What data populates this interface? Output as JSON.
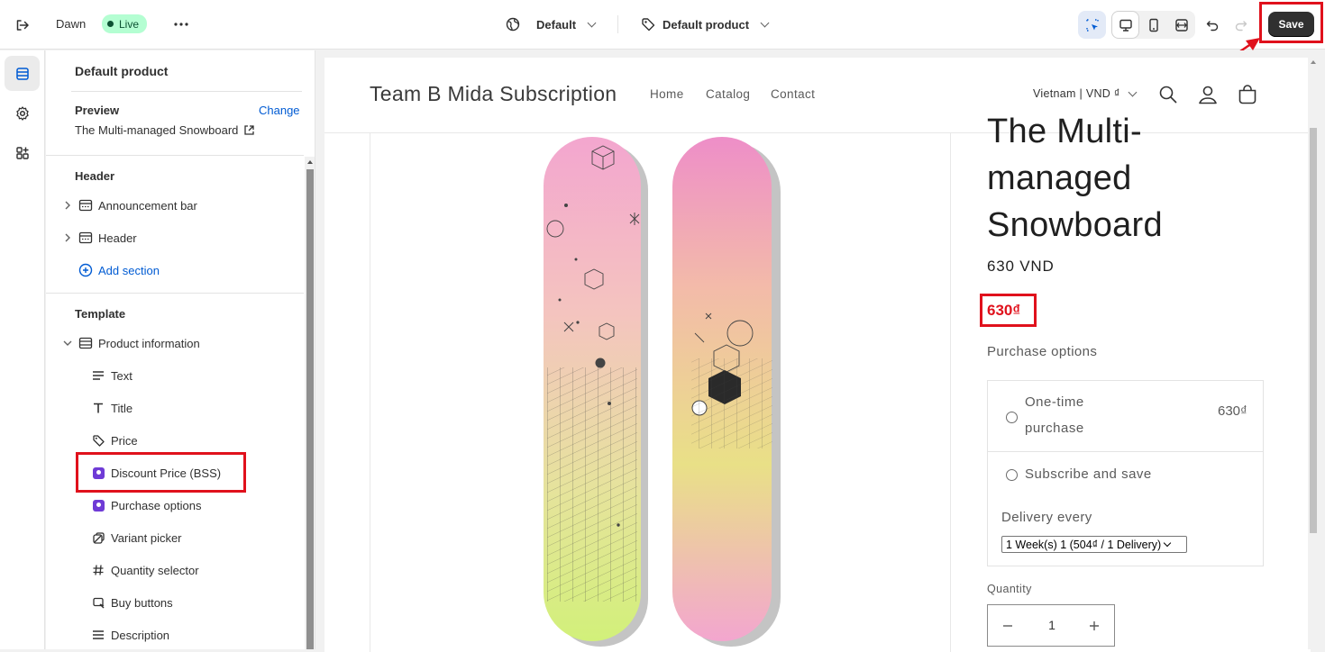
{
  "topbar": {
    "theme_name": "Dawn",
    "live_label": "Live",
    "more_label": "•••",
    "global_selector": "Default",
    "product_selector": "Default product",
    "save_label": "Save"
  },
  "panel": {
    "title": "Default product",
    "preview_label": "Preview",
    "change_label": "Change",
    "preview_value": "The Multi-managed Snowboard",
    "header_section_title": "Header",
    "header_items": [
      {
        "label": "Announcement bar",
        "icon": "section-icon"
      },
      {
        "label": "Header",
        "icon": "section-icon"
      }
    ],
    "add_section_label": "Add section",
    "template_section_title": "Template",
    "template_item": {
      "label": "Product information",
      "icon": "section-icon"
    },
    "blocks": [
      {
        "label": "Text",
        "icon": "text-icon"
      },
      {
        "label": "Title",
        "icon": "title-icon"
      },
      {
        "label": "Price",
        "icon": "price-tag-icon"
      },
      {
        "label": "Discount Price (BSS)",
        "icon": "app-block-icon"
      },
      {
        "label": "Purchase options",
        "icon": "app-block-icon"
      },
      {
        "label": "Variant picker",
        "icon": "variant-icon"
      },
      {
        "label": "Quantity selector",
        "icon": "hash-icon"
      },
      {
        "label": "Buy buttons",
        "icon": "cart-icon"
      },
      {
        "label": "Description",
        "icon": "text-icon"
      }
    ]
  },
  "store": {
    "name": "Team B Mida Subscription",
    "nav": [
      "Home",
      "Catalog",
      "Contact"
    ],
    "locale": "Vietnam | VND ₫",
    "product_title_lines": [
      "The Multi-",
      "managed",
      "Snowboard"
    ],
    "price": "630 VND",
    "discount_price": "630₫",
    "purchase_options_label": "Purchase options",
    "one_time_label_lines": [
      "One-time",
      "purchase"
    ],
    "one_time_price": "630₫",
    "subscribe_label": "Subscribe and save",
    "delivery_label": "Delivery every",
    "delivery_value": "1 Week(s) 1 (504₫ / 1 Delivery)",
    "quantity_label": "Quantity",
    "quantity_value": "1"
  },
  "colors": {
    "accent_link": "#005bd3",
    "highlight": "#e0111c",
    "live_bg": "#b4fed2",
    "save_bg": "#303030"
  }
}
